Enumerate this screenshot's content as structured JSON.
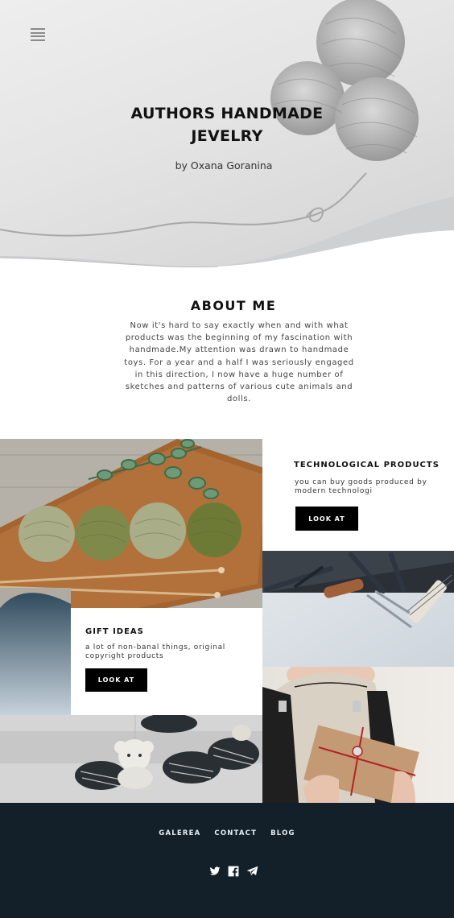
{
  "hero": {
    "title": "AUTHORS HANDMADE JEVELRY",
    "subtitle": "by Oxana Goranina"
  },
  "about": {
    "title": "ABOUT ME",
    "text": "Now it's hard to say exactly when and with what products was the beginning of my  fascination with handmade.My attention was drawn to handmade toys. For a year and a half I was seriously engaged in this direction, I now have a huge number of sketches and patterns of various cute animals and dolls."
  },
  "cards": {
    "tech": {
      "title": "TECHNOLOGICAL PRODUCTS",
      "text": "you can buy goods produced by modern technologi",
      "button": "LOOK AT"
    },
    "gifts": {
      "title": "GIFT IDEAS",
      "text": "a lot of non-banal things, original copyright products",
      "button": "LOOK AT"
    }
  },
  "footer": {
    "nav": [
      "GALEREA",
      "CONTACT",
      "BLOG"
    ],
    "socials": [
      "twitter-icon",
      "facebook-icon",
      "telegram-icon"
    ]
  },
  "colors": {
    "footer_bg": "#13202a",
    "button_bg": "#000000",
    "hero_bg": "#e6e6e6"
  }
}
